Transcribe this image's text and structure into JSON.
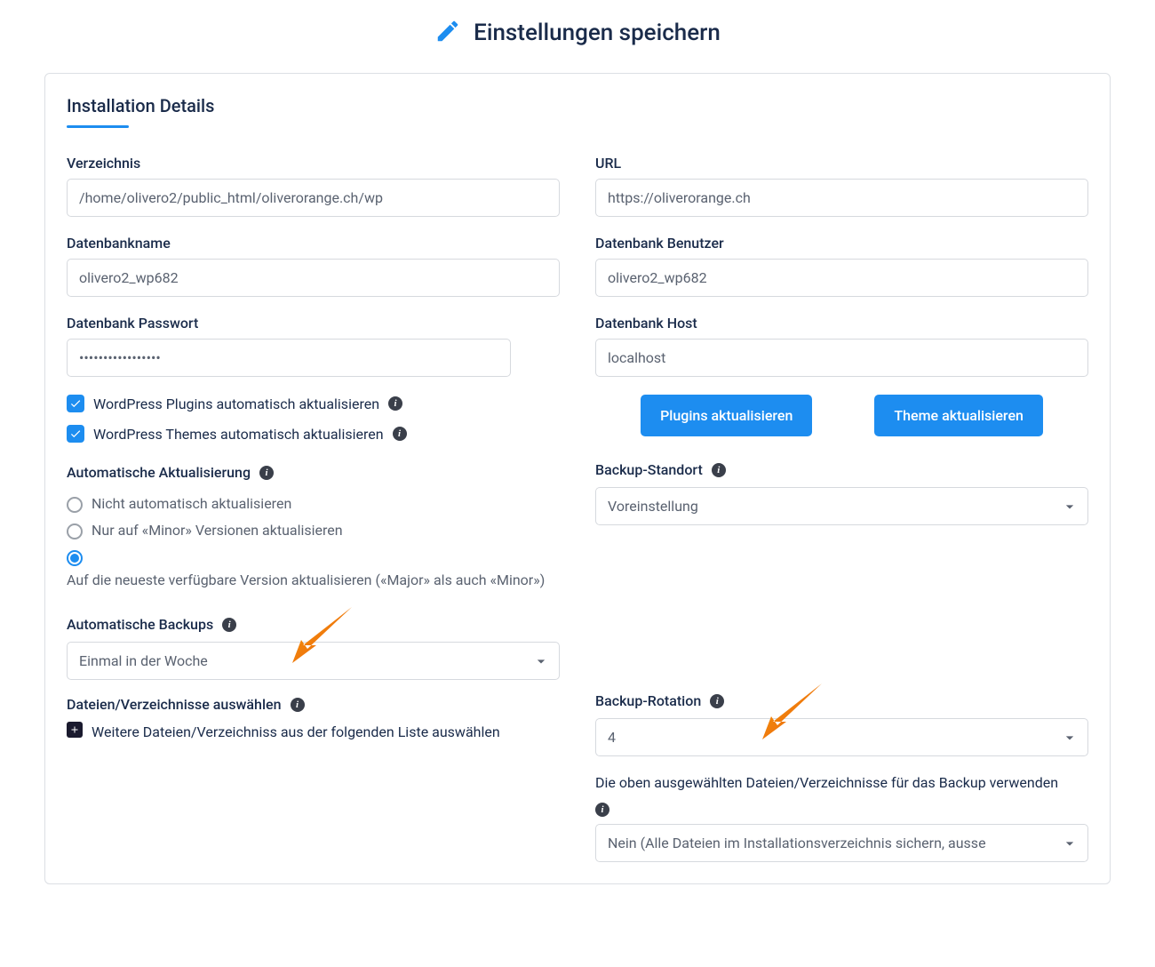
{
  "header": {
    "title": "Einstellungen speichern"
  },
  "panel": {
    "title": "Installation Details"
  },
  "left": {
    "directory": {
      "label": "Verzeichnis",
      "value": "/home/olivero2/public_html/oliverorange.ch/wp"
    },
    "dbname": {
      "label": "Datenbankname",
      "value": "olivero2_wp682"
    },
    "dbpass": {
      "label": "Datenbank Passwort",
      "value": "•••••••••••••••••"
    },
    "chk_plugins": "WordPress Plugins automatisch aktualisieren",
    "chk_themes": "WordPress Themes automatisch aktualisieren",
    "auto_update": {
      "label": "Automatische Aktualisierung",
      "opt_none": "Nicht automatisch aktualisieren",
      "opt_minor": "Nur auf «Minor» Versionen aktualisieren",
      "opt_major": "Auf die neueste verfügbare Version aktualisieren («Major» als auch «Minor»)"
    },
    "auto_backup": {
      "label": "Automatische Backups",
      "value": "Einmal in der Woche"
    },
    "files_select": {
      "label": "Dateien/Verzeichnisse auswählen",
      "add_more": "Weitere Dateien/Verzeichniss aus der folgenden Liste auswählen"
    }
  },
  "right": {
    "url": {
      "label": "URL",
      "value": "https://oliverorange.ch"
    },
    "dbuser": {
      "label": "Datenbank Benutzer",
      "value": "olivero2_wp682"
    },
    "dbhost": {
      "label": "Datenbank Host",
      "value": "localhost"
    },
    "btn_plugins": "Plugins aktualisieren",
    "btn_theme": "Theme aktualisieren",
    "backup_location": {
      "label": "Backup-Standort",
      "value": "Voreinstellung"
    },
    "backup_rotation": {
      "label": "Backup-Rotation",
      "value": "4"
    },
    "use_selected": {
      "label": "Die oben ausgewählten Dateien/Verzeichnisse für das Backup verwenden",
      "value": "Nein (Alle Dateien im Installationsverzeichnis sichern, ausse"
    }
  }
}
